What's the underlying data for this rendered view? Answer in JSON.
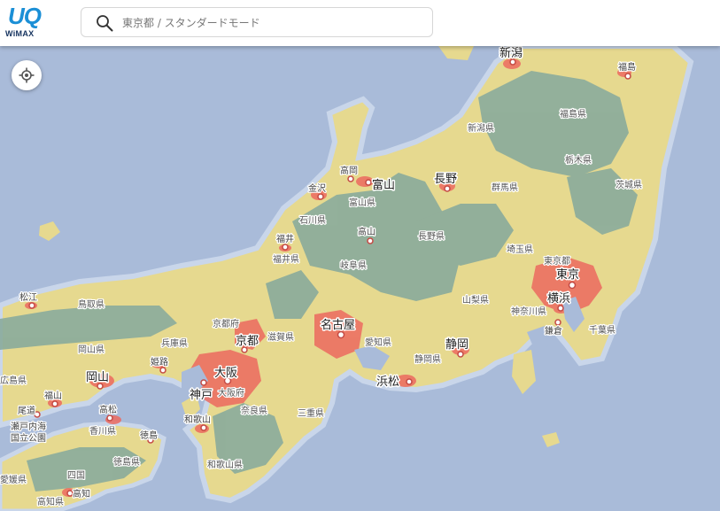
{
  "header": {
    "logo_main": "UQ",
    "logo_sub": "WiMAX",
    "search_placeholder": "東京都 / スタンダードモード"
  },
  "controls": {
    "search_icon": "search-icon",
    "locate_icon": "crosshair-icon"
  },
  "colors": {
    "water": "#a9bbd9",
    "coverage_low": "#e9dc8f",
    "coverage_high": "#ec6a60",
    "mountain": "#86a89a",
    "accent": "#1b8fd6"
  },
  "map": {
    "cities": [
      {
        "name": "東京",
        "tier": "big"
      },
      {
        "name": "横浜",
        "tier": "big"
      },
      {
        "name": "名古屋",
        "tier": "big"
      },
      {
        "name": "大阪",
        "tier": "big"
      },
      {
        "name": "京都",
        "tier": "big"
      },
      {
        "name": "神戸",
        "tier": "big"
      },
      {
        "name": "静岡",
        "tier": "big"
      },
      {
        "name": "浜松",
        "tier": "big"
      },
      {
        "name": "岡山",
        "tier": "big"
      },
      {
        "name": "富山",
        "tier": "big"
      },
      {
        "name": "長野",
        "tier": "big"
      },
      {
        "name": "新潟",
        "tier": "big"
      },
      {
        "name": "金沢",
        "tier": "small"
      },
      {
        "name": "高岡",
        "tier": "small"
      },
      {
        "name": "福井",
        "tier": "small"
      },
      {
        "name": "高山",
        "tier": "small"
      },
      {
        "name": "姫路",
        "tier": "small"
      },
      {
        "name": "福山",
        "tier": "small"
      },
      {
        "name": "高松",
        "tier": "small"
      },
      {
        "name": "徳島",
        "tier": "small"
      },
      {
        "name": "和歌山",
        "tier": "small"
      },
      {
        "name": "高知",
        "tier": "small"
      },
      {
        "name": "松江",
        "tier": "small"
      },
      {
        "name": "尾道",
        "tier": "small"
      },
      {
        "name": "鎌倉",
        "tier": "small"
      },
      {
        "name": "福島",
        "tier": "small"
      }
    ],
    "prefectures": [
      "福島県",
      "新潟県",
      "栃木県",
      "群馬県",
      "茨城県",
      "埼玉県",
      "東京都",
      "千葉県",
      "神奈川県",
      "山梨県",
      "長野県",
      "静岡県",
      "愛知県",
      "岐阜県",
      "富山県",
      "石川県",
      "福井県",
      "滋賀県",
      "京都府",
      "大阪府",
      "奈良県",
      "三重県",
      "和歌山県",
      "兵庫県",
      "鳥取県",
      "岡山県",
      "広島県",
      "香川県",
      "徳島県",
      "高知県",
      "愛媛県"
    ],
    "park_label": "瀬戸内海 国立公園",
    "park_line1": "瀬戸内海",
    "park_line2": "国立公園",
    "extra_labels": [
      "四国",
      "高知県"
    ]
  }
}
